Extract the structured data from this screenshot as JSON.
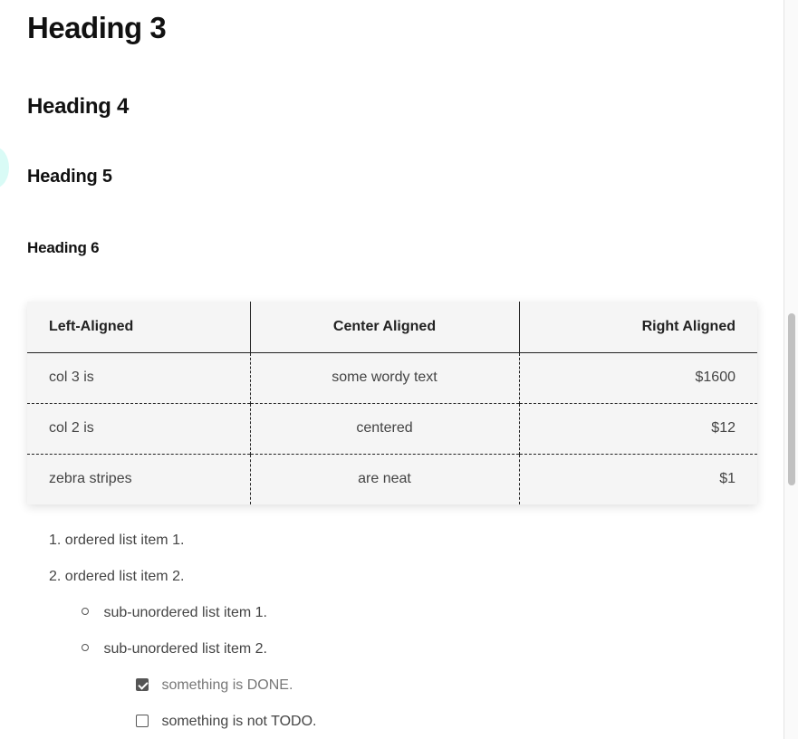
{
  "headings": {
    "h3": "Heading 3",
    "h4": "Heading 4",
    "h5": "Heading 5",
    "h6": "Heading 6"
  },
  "table": {
    "headers": [
      "Left-Aligned",
      "Center Aligned",
      "Right Aligned"
    ],
    "rows": [
      [
        "col 3 is",
        "some wordy text",
        "$1600"
      ],
      [
        "col 2 is",
        "centered",
        "$12"
      ],
      [
        "zebra stripes",
        "are neat",
        "$1"
      ]
    ]
  },
  "ordered_list": {
    "items": [
      {
        "marker": "1.",
        "text": "ordered list item 1."
      },
      {
        "marker": "2.",
        "text": "ordered list item 2."
      }
    ]
  },
  "unordered_list": {
    "items": [
      {
        "text": "sub-unordered list item 1."
      },
      {
        "text": "sub-unordered list item 2."
      }
    ]
  },
  "task_list": {
    "items": [
      {
        "text": "something is DONE.",
        "checked": true
      },
      {
        "text": "something is not TODO.",
        "checked": false
      }
    ]
  },
  "colors": {
    "table_background": "#f5f5f5",
    "decoration_circle": "#d9fbf6"
  }
}
